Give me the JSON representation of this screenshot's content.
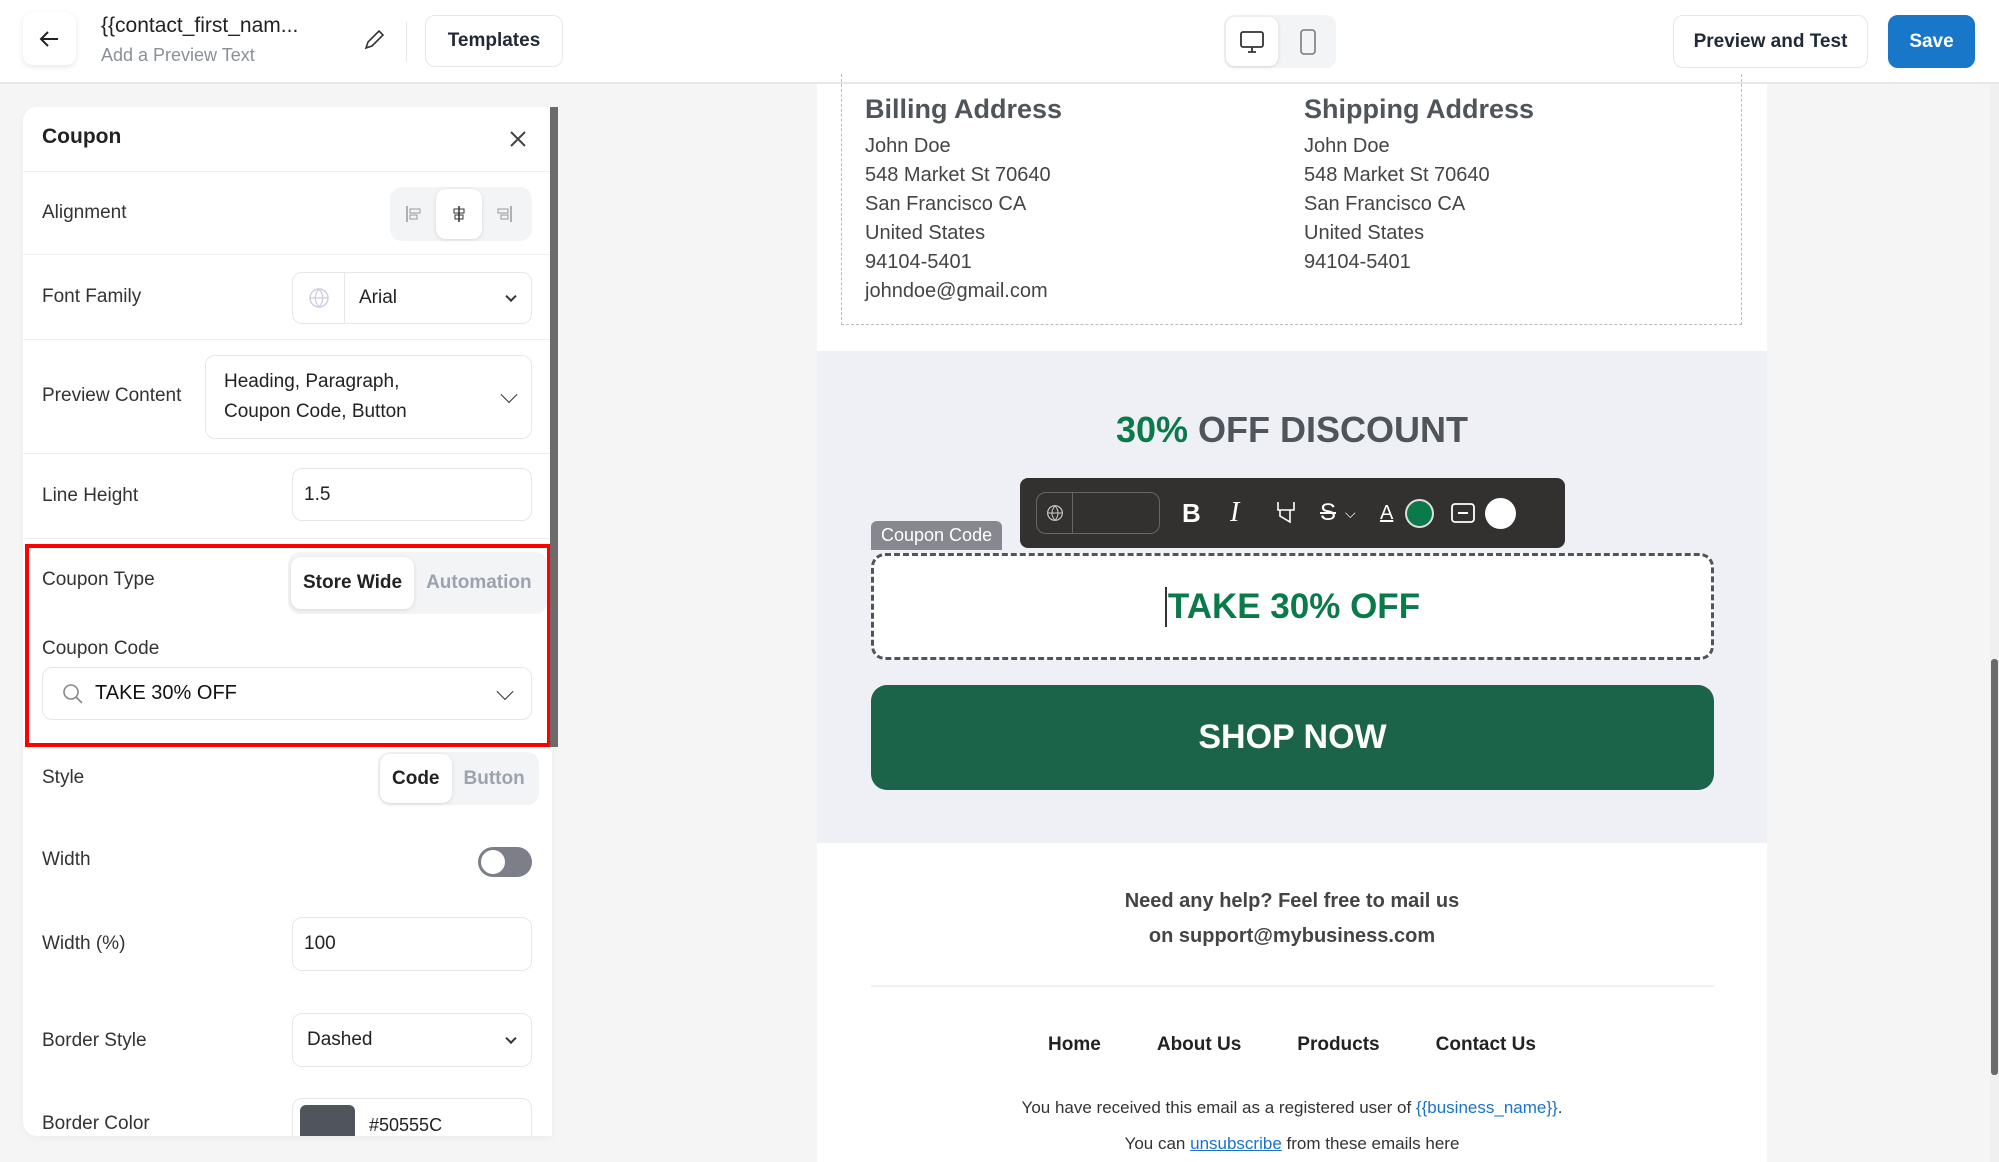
{
  "header": {
    "title": "{{contact_first_nam...",
    "subtitle": "Add a Preview Text",
    "templates_label": "Templates",
    "preview_label": "Preview and Test",
    "save_label": "Save",
    "active_device": "desktop"
  },
  "panel": {
    "title": "Coupon",
    "alignment": {
      "label": "Alignment",
      "selected": "center"
    },
    "font_family": {
      "label": "Font Family",
      "value": "Arial"
    },
    "preview_content": {
      "label": "Preview Content",
      "value": "Heading, Paragraph, Coupon Code, Button"
    },
    "line_height": {
      "label": "Line Height",
      "value": "1.5"
    },
    "coupon_type": {
      "label": "Coupon Type",
      "options": [
        "Store Wide",
        "Automation"
      ],
      "selected": "Store Wide"
    },
    "coupon_code": {
      "label": "Coupon Code",
      "value": "TAKE 30% OFF"
    },
    "style": {
      "label": "Style",
      "options": [
        "Code",
        "Button"
      ],
      "selected": "Code"
    },
    "width": {
      "label": "Width",
      "toggle": false
    },
    "width_pct": {
      "label": "Width (%)",
      "value": "100"
    },
    "border_style": {
      "label": "Border Style",
      "value": "Dashed"
    },
    "border_color": {
      "label": "Border Color",
      "value": "#50555C"
    }
  },
  "email": {
    "billing": {
      "heading": "Billing Address",
      "lines": [
        "John Doe",
        "548 Market St 70640",
        "San Francisco CA",
        "United States",
        "94104-5401",
        "johndoe@gmail.com"
      ]
    },
    "shipping": {
      "heading": "Shipping Address",
      "lines": [
        "John Doe",
        "548 Market St 70640",
        "San Francisco CA",
        "United States",
        "94104-5401"
      ]
    },
    "discount_highlight": "30%",
    "discount_rest": " OFF DISCOUNT",
    "coupon_tag": "Coupon Code",
    "coupon_code": "TAKE 30% OFF",
    "shop_button": "SHOP NOW",
    "help_line1": "Need any help? Feel free to mail us",
    "help_line2": "on support@mybusiness.com",
    "nav": [
      "Home",
      "About Us",
      "Products",
      "Contact Us"
    ],
    "received_text": "You have received this email as a registered user of ",
    "business_name": "{{business_name}}",
    "period": ".",
    "unsub_pre": "You can ",
    "unsub_link": "unsubscribe",
    "unsub_post": " from these emails here"
  },
  "colors": {
    "accent": "#1a73c8",
    "green": "#0b7a4b",
    "shop_button": "#1b6449",
    "highlight_box": "#ff0000",
    "toolbar": "#333030",
    "text_color_swatch": "#0b7a4b",
    "bg_color_swatch": "#ffffff"
  }
}
